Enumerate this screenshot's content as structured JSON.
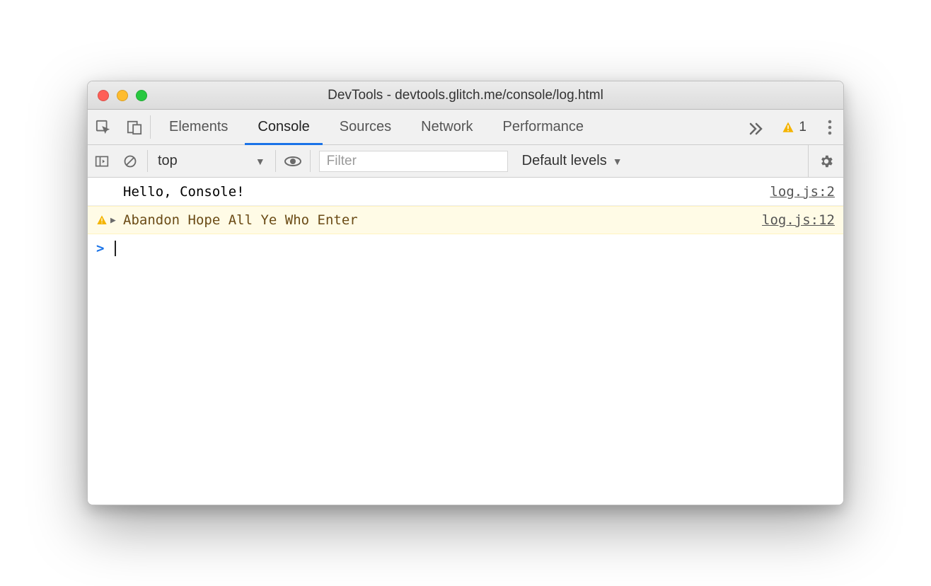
{
  "window": {
    "title": "DevTools - devtools.glitch.me/console/log.html"
  },
  "tabs": {
    "items": [
      "Elements",
      "Console",
      "Sources",
      "Network",
      "Performance"
    ],
    "active_index": 1,
    "warning_count": "1"
  },
  "filterbar": {
    "context": "top",
    "filter_placeholder": "Filter",
    "levels_label": "Default levels"
  },
  "console": {
    "rows": [
      {
        "type": "log",
        "text": "Hello, Console!",
        "source": "log.js:2"
      },
      {
        "type": "warn",
        "text": "Abandon Hope All Ye Who Enter",
        "source": "log.js:12"
      }
    ],
    "prompt": ">"
  }
}
